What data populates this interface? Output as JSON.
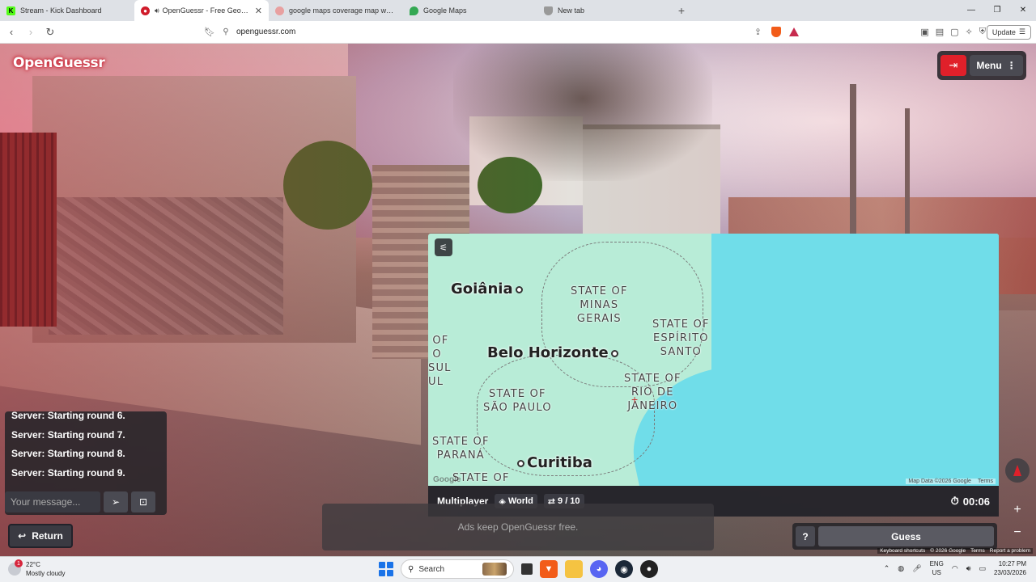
{
  "browser": {
    "tabs": [
      {
        "title": "Stream - Kick Dashboard",
        "favicon": "kick-icon",
        "color": "#53fc18"
      },
      {
        "title": "OpenGuessr - Free GeoGuessr",
        "favicon": "openguessr-icon",
        "color": "#d01c2b",
        "active": true
      },
      {
        "title": "google maps coverage map world - G",
        "favicon": "brave-search-icon",
        "color": "#e23a2e"
      },
      {
        "title": "Google Maps",
        "favicon": "google-maps-icon",
        "color": "#34a853"
      },
      {
        "title": "New tab",
        "favicon": "brave-icon",
        "color": "#888888"
      }
    ],
    "url": "openguessr.com",
    "update_label": "Update"
  },
  "game": {
    "logo": "OpenGuessr",
    "menu_label": "Menu",
    "map": {
      "states": [
        {
          "id": "minas",
          "text": "STATE OF\nMINAS\nGERAIS"
        },
        {
          "id": "espirito",
          "text": "STATE OF\nESPÍRITO\nSANTO"
        },
        {
          "id": "rio",
          "text": "STATE OF\nRIO DE\nJANEIRO"
        },
        {
          "id": "saopaulo",
          "text": "STATE OF\nSÃO PAULO"
        },
        {
          "id": "parana",
          "text": "STATE OF\nPARANÁ"
        },
        {
          "id": "partial_top",
          "text": "STATE OF"
        },
        {
          "id": "partial_left",
          "text": "OF\nO\nSUL\nUL"
        }
      ],
      "cities": [
        "Goiânia",
        "Belo Horizonte",
        "Curitiba"
      ],
      "attribution": "Map Data ©2026 Google",
      "terms": "Terms",
      "google_mark": "Google"
    },
    "status": {
      "mode": "Multiplayer",
      "region": "World",
      "round": "9 / 10",
      "timer": "00:06"
    },
    "ads_text": "Ads keep OpenGuessr free.",
    "chat": {
      "messages": [
        "Server: Starting round 6.",
        "Server: Starting round 7.",
        "Server: Starting round 8.",
        "Server: Starting round 9."
      ],
      "placeholder": "Your message..."
    },
    "return_label": "Return",
    "help_label": "?",
    "guess_label": "Guess",
    "streetview_footer": [
      "Keyboard shortcuts",
      "© 2026 Google",
      "Terms",
      "Report a problem"
    ]
  },
  "taskbar": {
    "weather_temp": "22°C",
    "weather_desc": "Mostly cloudy",
    "weather_badge": "1",
    "search_label": "Search",
    "lang_1": "ENG",
    "lang_2": "US",
    "time": "10:27 PM",
    "date": "23/03/2026"
  }
}
